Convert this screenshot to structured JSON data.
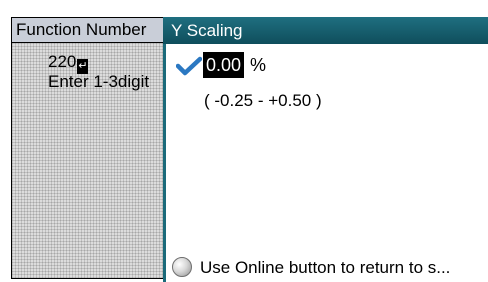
{
  "left_pane": {
    "title": "Function Number",
    "value": "220",
    "enter_symbol": "↵",
    "hint": "Enter 1-3digit"
  },
  "right_pane": {
    "title": "Y Scaling",
    "check_icon": "checkmark-icon",
    "value": "0.00",
    "unit": "%",
    "range": "( -0.25 - +0.50 )"
  },
  "footer": {
    "icon": "online-button-icon",
    "text": "Use Online button to return to s..."
  },
  "colors": {
    "header_teal": "#1f6f80",
    "check_blue": "#2b78c2",
    "left_header_bg": "#c9ced8"
  }
}
